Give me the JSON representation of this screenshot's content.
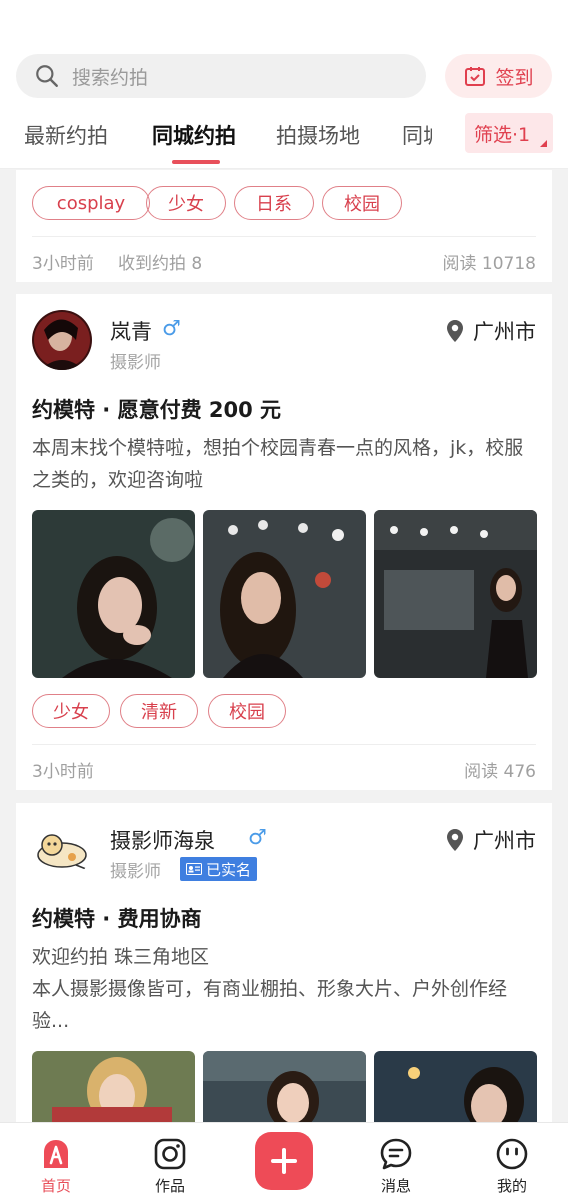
{
  "header": {
    "search_placeholder": "搜索约拍",
    "signin_label": "签到",
    "tabs": [
      "最新约拍",
      "同城约拍",
      "拍摄场地",
      "同城"
    ],
    "filter_label": "筛选·1"
  },
  "posts": [
    {
      "tags": [
        "cosplay",
        "少女",
        "日系",
        "校园"
      ],
      "time": "3小时前",
      "received": "收到约拍 8",
      "reads": "阅读 10718"
    },
    {
      "name": "岚青",
      "gender": "♂",
      "role": "摄影师",
      "location": "广州市",
      "title": "约模特 · 愿意付费 200 元",
      "desc": "本周末找个模特啦，想拍个校园青春一点的风格，jk，校服之类的，欢迎咨询啦",
      "tags": [
        "少女",
        "清新",
        "校园"
      ],
      "time": "3小时前",
      "reads": "阅读 476"
    },
    {
      "name": "摄影师海泉",
      "gender": "♂",
      "role": "摄影师",
      "verified": "已实名",
      "location": "广州市",
      "title": "约模特 · 费用协商",
      "desc_line1": "欢迎约拍 珠三角地区",
      "desc_line2": "本人摄影摄像皆可，有商业棚拍、形象大片、户外创作经验..."
    }
  ],
  "bottom_nav": [
    "首页",
    "作品",
    "消息",
    "我的"
  ],
  "colors": {
    "accent": "#e8505b",
    "tag_border": "#e08088",
    "verified": "#3f7fe0"
  }
}
